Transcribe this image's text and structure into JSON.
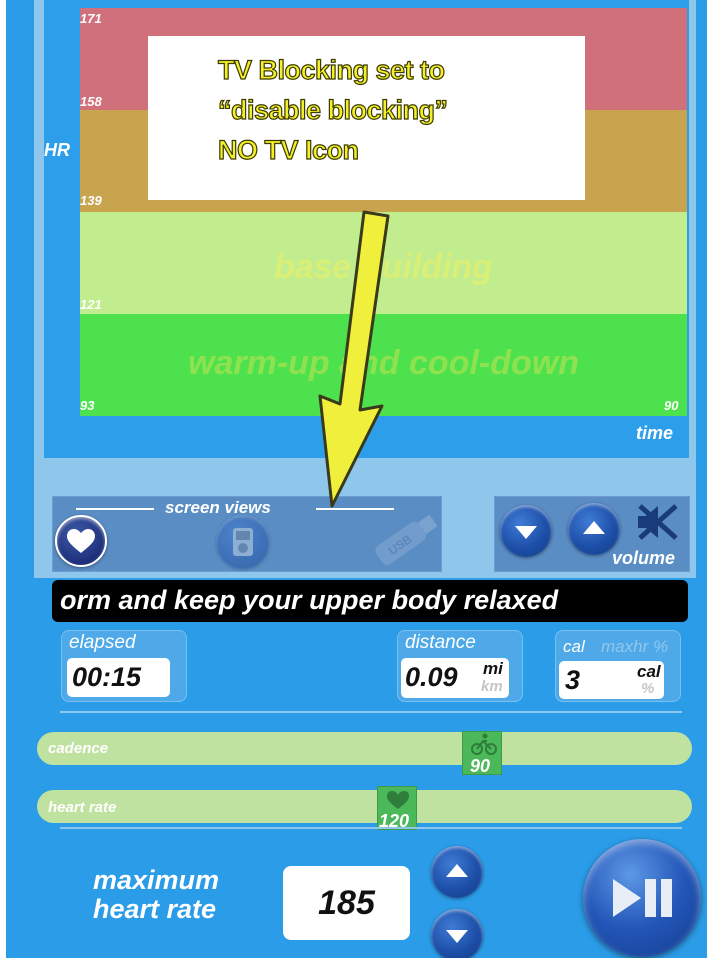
{
  "chart": {
    "y_axis_label": "HR",
    "x_axis_label": "time",
    "x_end_tick": "90",
    "ticks": [
      "171",
      "158",
      "139",
      "121",
      "93"
    ],
    "zones": [
      {
        "name": "",
        "color": "#d0707a",
        "label_color": "#d0707a"
      },
      {
        "name": "",
        "color": "#c9a44e",
        "label_color": "#c9a44e"
      },
      {
        "name": "base building",
        "color": "#c2ed8e",
        "label_color": "#d9ef75"
      },
      {
        "name": "warm-up and cool-down",
        "color": "#4ee14e",
        "label_color": "#8ee24f"
      }
    ]
  },
  "annotation": {
    "line1": "TV Blocking set to",
    "line2": "“disable blocking”",
    "line3": "NO TV  Icon"
  },
  "screen_views": {
    "title": "screen views",
    "icons": [
      "heart-icon",
      "ipod-icon",
      "usb-icon"
    ],
    "usb_text": "USB"
  },
  "volume": {
    "label": "volume",
    "icons": [
      "chevron-down-icon",
      "chevron-up-icon",
      "mute-icon"
    ]
  },
  "message": "orm and keep your upper body relaxed",
  "stats": {
    "elapsed": {
      "title": "elapsed",
      "value": "00:15"
    },
    "distance": {
      "title": "distance",
      "value": "0.09",
      "unit_active": "mi",
      "unit_inactive": "km"
    },
    "calories": {
      "title": "cal",
      "title_inactive": "maxhr %",
      "value": "3",
      "unit_active": "cal",
      "unit_inactive": "%"
    }
  },
  "sliders": {
    "cadence": {
      "label": "cadence",
      "value": "90",
      "icon": "bike-icon"
    },
    "heart_rate": {
      "label": "heart rate",
      "value": "120",
      "icon": "heart-icon"
    }
  },
  "max_heart_rate": {
    "label_line1": "maximum",
    "label_line2": "heart rate",
    "value": "185"
  },
  "colors": {
    "app_bg": "#2b9ce8",
    "panel": "#5a8dc4",
    "button_blue": "#1d4fa8",
    "annotation_text": "#f4ef2a",
    "slider_track": "#bfe2a0",
    "slider_thumb": "#4bb85a"
  }
}
